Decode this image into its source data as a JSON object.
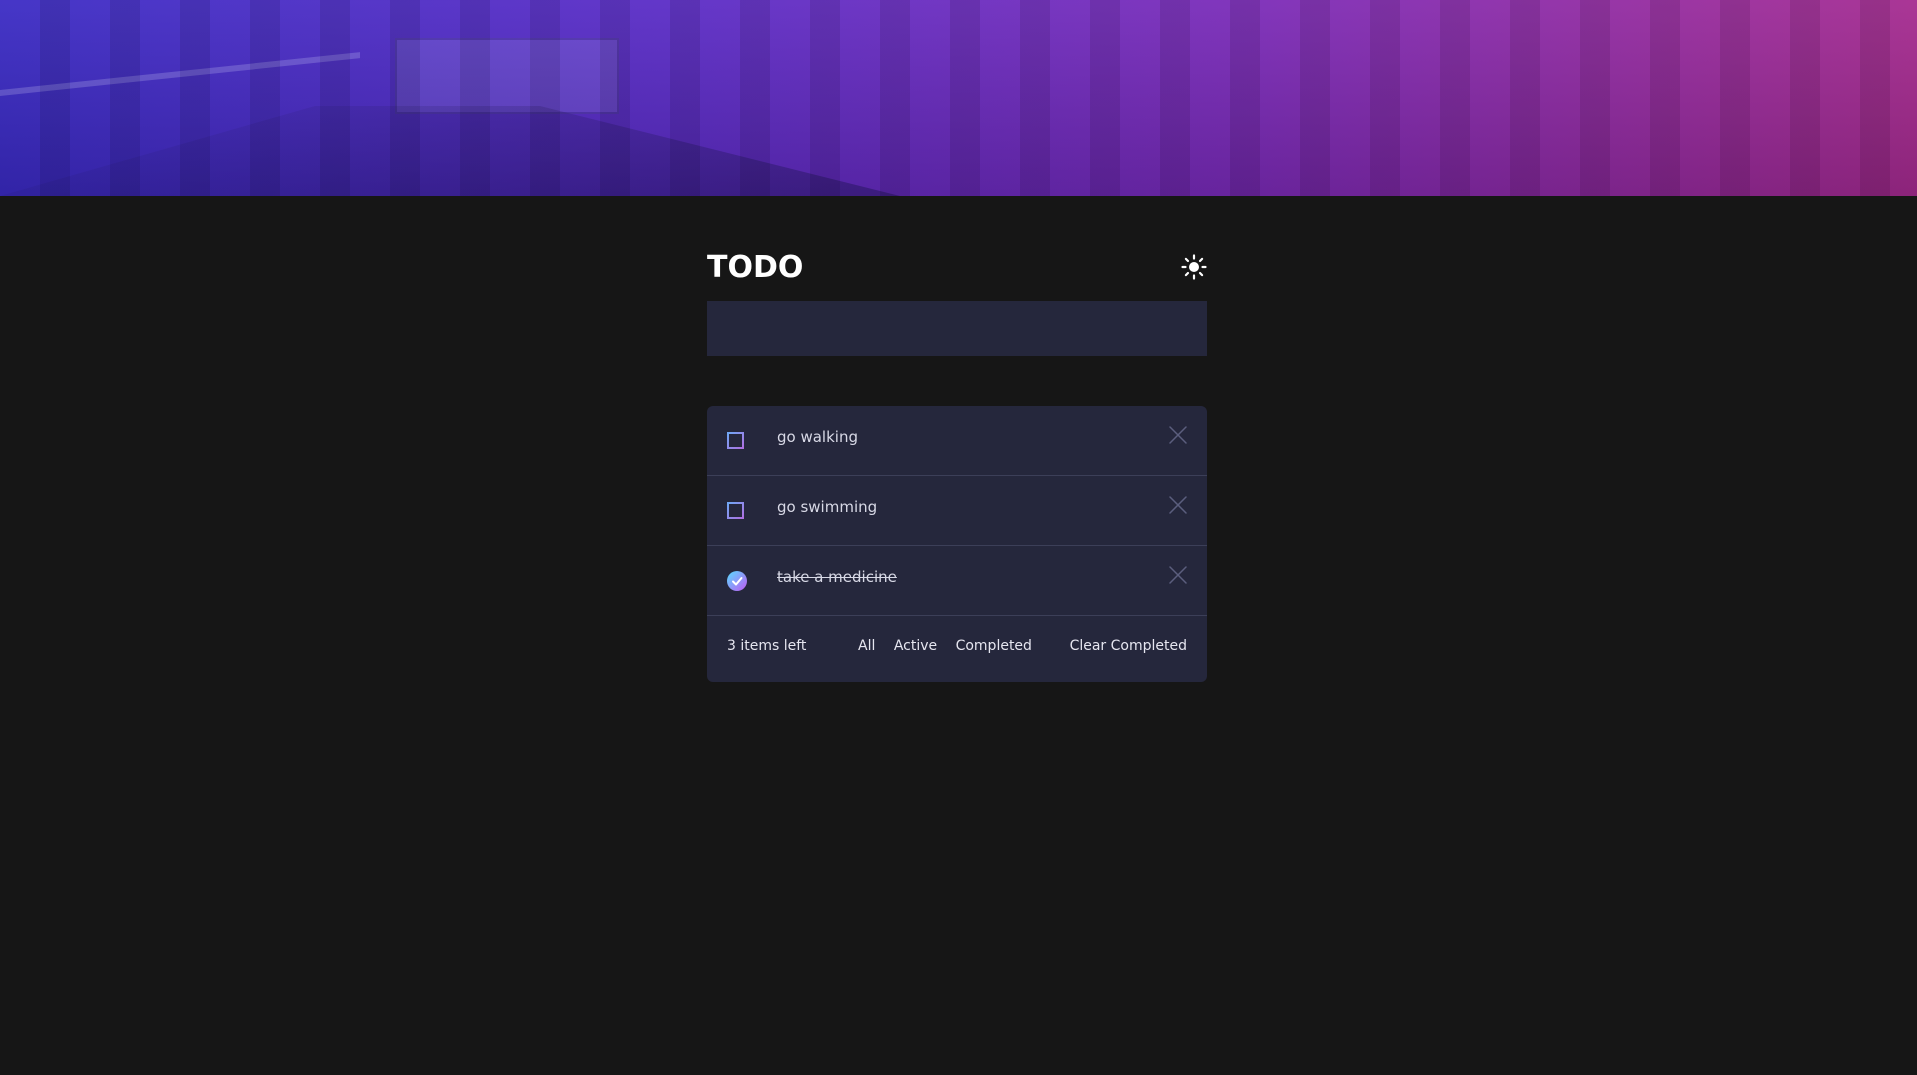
{
  "header": {
    "title": "TODO",
    "theme_icon": "sun-icon"
  },
  "new_todo": {
    "placeholder": "",
    "value": ""
  },
  "todos": [
    {
      "text": "go walking",
      "completed": false
    },
    {
      "text": "go swimming",
      "completed": false
    },
    {
      "text": "take a medicine",
      "completed": true
    }
  ],
  "footer": {
    "items_left": "3 items left",
    "filter_all": "All",
    "filter_active": "Active",
    "filter_completed": "Completed",
    "clear_completed": "Clear Completed"
  },
  "colors": {
    "page_bg": "#161616",
    "panel_bg": "#25273c",
    "divider": "#3c3f58",
    "check_gradient_start": "#57ddff",
    "check_gradient_end": "#c058f3",
    "hero_gradient_start": "#3a2ac4",
    "hero_gradient_end": "#a52a8f"
  }
}
